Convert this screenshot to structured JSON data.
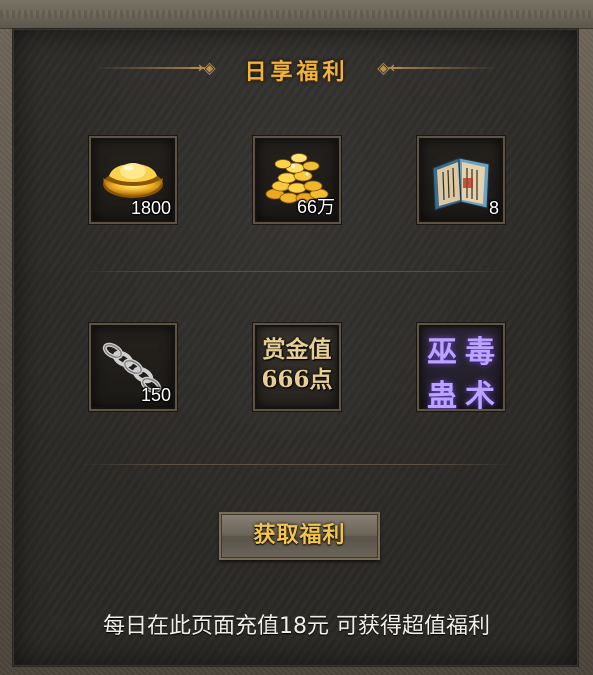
{
  "title": "日享福利",
  "title_ornament_left": "→◈",
  "title_ornament_right": "◈←",
  "items": [
    {
      "name": "gold-ingot",
      "icon": "gold-ingot-icon",
      "qty": "1800"
    },
    {
      "name": "gold-coins",
      "icon": "gold-coins-icon",
      "qty": "66万"
    },
    {
      "name": "skill-book",
      "icon": "book-icon",
      "qty": "8"
    },
    {
      "name": "silver-chain",
      "icon": "chain-icon",
      "qty": "150"
    },
    {
      "name": "bounty-value",
      "line1": "赏金值",
      "line2": "666点"
    },
    {
      "name": "wugu-dushu",
      "chars": [
        "巫",
        "毒",
        "蛊",
        "术"
      ]
    }
  ],
  "button_label": "获取福利",
  "footer_text": "每日在此页面充值18元 可获得超值福利",
  "colors": {
    "title": "#f0b33b",
    "button_text": "#f3c448",
    "footer_text": "#f2efe8",
    "wugu_text": "#b9a5ff"
  }
}
